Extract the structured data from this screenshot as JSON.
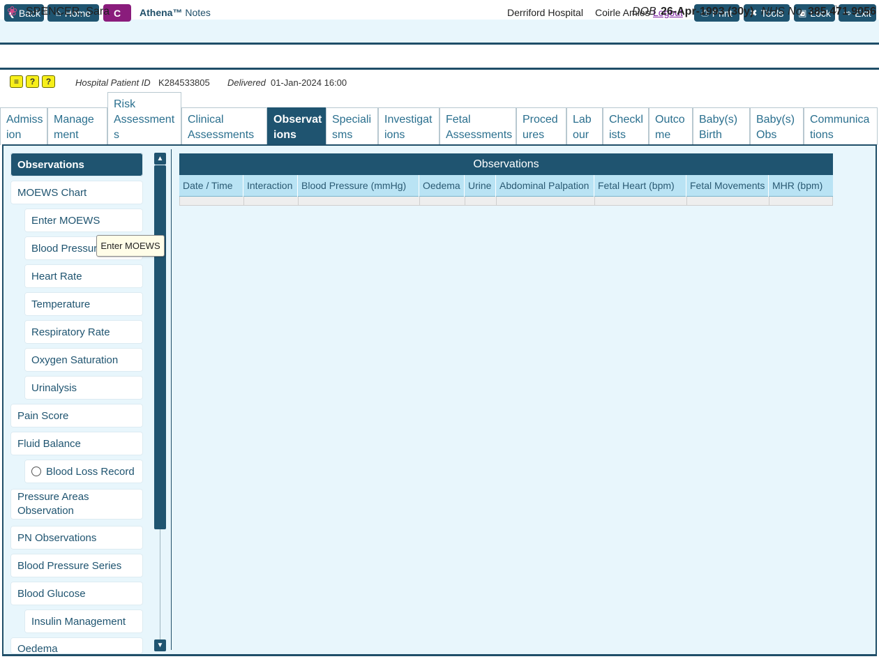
{
  "window": {
    "title": "Athena"
  },
  "toolbar": {
    "back": "Back",
    "home": "Home",
    "c": "C",
    "app_brand": "Athena™",
    "app_module": "Notes",
    "hospital": "Derriford Hospital",
    "user": "Coirle Amies",
    "logout": "Logout",
    "print": "Print",
    "tools": "Tools",
    "lock": "Lock",
    "exit": "Exit"
  },
  "patient": {
    "name": "SPENCER, Sara",
    "dob_label": "DOB",
    "dob": "26-Apr-1993 (30y)",
    "nhs_label": "NHS No.",
    "nhs": "385 471 9056",
    "hospital_id_label": "Hospital Patient ID",
    "hospital_id": "K284533805",
    "delivered_label": "Delivered",
    "delivered": "01-Jan-2024 16:00"
  },
  "tabs": [
    {
      "l1": "Admiss",
      "l2": "ion"
    },
    {
      "l1": "Manage",
      "l2": "ment"
    },
    {
      "l1": "Risk",
      "l2": "Assessment",
      "l3": "s"
    },
    {
      "l1": "Clinical",
      "l2": "Assessments"
    },
    {
      "l1": "Observat",
      "l2": "ions"
    },
    {
      "l1": "Speciali",
      "l2": "sms"
    },
    {
      "l1": "Investigat",
      "l2": "ions"
    },
    {
      "l1": "Fetal",
      "l2": "Assessments"
    },
    {
      "l1": "Proced",
      "l2": "ures"
    },
    {
      "l1": "Lab",
      "l2": "our"
    },
    {
      "l1": "Checkl",
      "l2": "ists"
    },
    {
      "l1": "Outco",
      "l2": "me"
    },
    {
      "l1": "Baby(s)",
      "l2": "Birth"
    },
    {
      "l1": "Baby(s)",
      "l2": "Obs"
    },
    {
      "l1": "Communica",
      "l2": "tions"
    }
  ],
  "sidebar": [
    "Observations",
    "MOEWS Chart",
    "Enter MOEWS",
    "Blood Pressure",
    "Heart Rate",
    "Temperature",
    "Respiratory Rate",
    "Oxygen Saturation",
    "Urinalysis",
    "Pain Score",
    "Fluid Balance",
    "Blood Loss Record",
    "Pressure Areas",
    "Observation",
    "PN Observations",
    "Blood Pressure Series",
    "Blood Glucose",
    "Insulin Management",
    "Oedema"
  ],
  "tooltip": "Enter MOEWS",
  "observations": {
    "title": "Observations",
    "columns": [
      "Date / Time",
      "Interaction",
      "Blood Pressure (mmHg)",
      "Oedema",
      "Urine",
      "Abdominal Palpation",
      "Fetal Heart (bpm)",
      "Fetal Movements",
      "MHR (bpm)"
    ]
  }
}
